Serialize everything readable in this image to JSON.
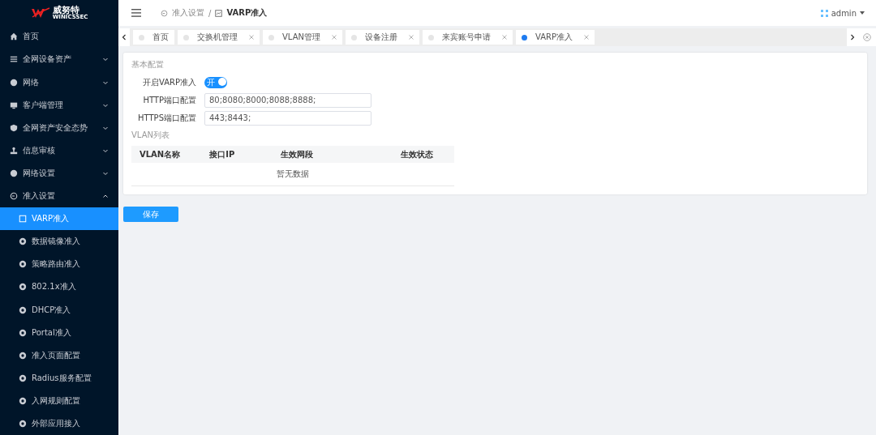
{
  "brand": {
    "name": "威努特",
    "sub": "WINICSSEC"
  },
  "sidebar": {
    "items": [
      {
        "label": "首页"
      },
      {
        "label": "全网设备资产",
        "expanded": false
      },
      {
        "label": "网络",
        "expanded": false
      },
      {
        "label": "客户端管理",
        "expanded": false
      },
      {
        "label": "全网资产安全态势",
        "expanded": false
      },
      {
        "label": "信息审核",
        "expanded": false
      },
      {
        "label": "网络设置",
        "expanded": false
      },
      {
        "label": "准入设置",
        "expanded": true,
        "children": [
          {
            "label": "VARP准入",
            "selected": true
          },
          {
            "label": "数据镜像准入",
            "selected": false
          },
          {
            "label": "策略路由准入",
            "selected": false
          },
          {
            "label": "802.1x准入",
            "selected": false
          },
          {
            "label": "DHCP准入",
            "selected": false
          },
          {
            "label": "Portal准入",
            "selected": false
          },
          {
            "label": "准入页面配置",
            "selected": false
          },
          {
            "label": "Radius服务配置",
            "selected": false
          },
          {
            "label": "入网规则配置",
            "selected": false
          },
          {
            "label": "外部应用接入",
            "selected": false
          }
        ]
      }
    ]
  },
  "breadcrumb": [
    "准入设置",
    "VARP准入"
  ],
  "breadcrumb_separator": "/",
  "user": "admin",
  "tabs": [
    {
      "label": "首页",
      "selected": false,
      "closable": false
    },
    {
      "label": "交换机管理",
      "selected": false,
      "closable": true
    },
    {
      "label": "VLAN管理",
      "selected": false,
      "closable": true
    },
    {
      "label": "设备注册",
      "selected": false,
      "closable": true
    },
    {
      "label": "来宾账号申请",
      "selected": false,
      "closable": true
    },
    {
      "label": "VARP准入",
      "selected": true,
      "closable": true
    }
  ],
  "form": {
    "section": "基本配置",
    "fields": [
      {
        "kind": "switch",
        "label": "开启VARP准入",
        "on": true,
        "text": "开"
      },
      {
        "kind": "input",
        "label": "HTTP端口配置",
        "value": "80;8080;8000;8088;8888;"
      },
      {
        "kind": "input",
        "label": "HTTPS端口配置",
        "value": "443;8443;"
      }
    ],
    "table_title": "VLAN列表",
    "table": {
      "columns": [
        "VLAN名称",
        "接口IP",
        "生效网段",
        "生效状态"
      ],
      "empty": "暂无数据"
    }
  },
  "save_button": "保存"
}
